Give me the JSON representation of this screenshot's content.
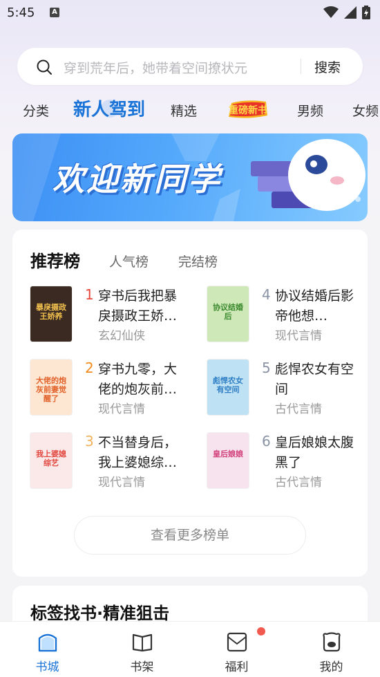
{
  "status_bar": {
    "time": "5:45",
    "notification_icon": "a-icon"
  },
  "search": {
    "placeholder": "穿到荒年后，她带着空间撩状元",
    "button_label": "搜索"
  },
  "tabs": [
    {
      "label": "分类",
      "active": false
    },
    {
      "label": "新人驾到",
      "active": true
    },
    {
      "label": "精选",
      "active": false
    },
    {
      "label": "重磅新书",
      "active": false,
      "style": "badge"
    },
    {
      "label": "男频",
      "active": false
    },
    {
      "label": "女频",
      "active": false
    }
  ],
  "banner": {
    "text": "欢迎新同学"
  },
  "ranking": {
    "tabs": [
      "推荐榜",
      "人气榜",
      "完结榜"
    ],
    "books": [
      {
        "rank": "1",
        "title": "穿书后我把暴戾摄政王娇…",
        "genre": "玄幻仙侠",
        "cover_title": "暴戾摄政王娇养",
        "cover_bg": "#3b2a22",
        "cover_fg": "#f2c14e",
        "rank_color": "#e8453c"
      },
      {
        "rank": "2",
        "title": "穿书九零，大佬的炮灰前…",
        "genre": "现代言情",
        "cover_title": "大佬的炮灰前妻觉醒了",
        "cover_bg": "#fde7d2",
        "cover_fg": "#e2622b",
        "rank_color": "#f08a1d"
      },
      {
        "rank": "3",
        "title": "不当替身后，我上婆媳综…",
        "genre": "现代言情",
        "cover_title": "我上婆媳综艺",
        "cover_bg": "#fbe9ea",
        "cover_fg": "#e2473f",
        "rank_color": "#f0b25a"
      },
      {
        "rank": "4",
        "title": "协议结婚后影帝他想…",
        "genre": "现代言情",
        "cover_title": "协议结婚后",
        "cover_bg": "#cfe8b8",
        "cover_fg": "#3c8a2f",
        "rank_color": "#8a93a6"
      },
      {
        "rank": "5",
        "title": "彪悍农女有空间",
        "genre": "古代言情",
        "cover_title": "彪悍农女有空间",
        "cover_bg": "#bfe1f4",
        "cover_fg": "#2f7fc4",
        "rank_color": "#8a93a6"
      },
      {
        "rank": "6",
        "title": "皇后娘娘太腹黑了",
        "genre": "古代言情",
        "cover_title": "皇后娘娘",
        "cover_bg": "#f7e3ee",
        "cover_fg": "#d2407a",
        "rank_color": "#8a93a6"
      }
    ],
    "more_label": "查看更多榜单"
  },
  "tag_section": {
    "title": "标签找书·精准狙击"
  },
  "bottom_nav": [
    {
      "label": "书城",
      "icon": "home-icon",
      "active": true
    },
    {
      "label": "书架",
      "icon": "book-open-icon",
      "active": false
    },
    {
      "label": "福利",
      "icon": "envelope-icon",
      "active": false,
      "dot": true
    },
    {
      "label": "我的",
      "icon": "bear-icon",
      "active": false
    }
  ],
  "colors": {
    "accent": "#1a73d6",
    "notification_dot": "#f25a50"
  }
}
